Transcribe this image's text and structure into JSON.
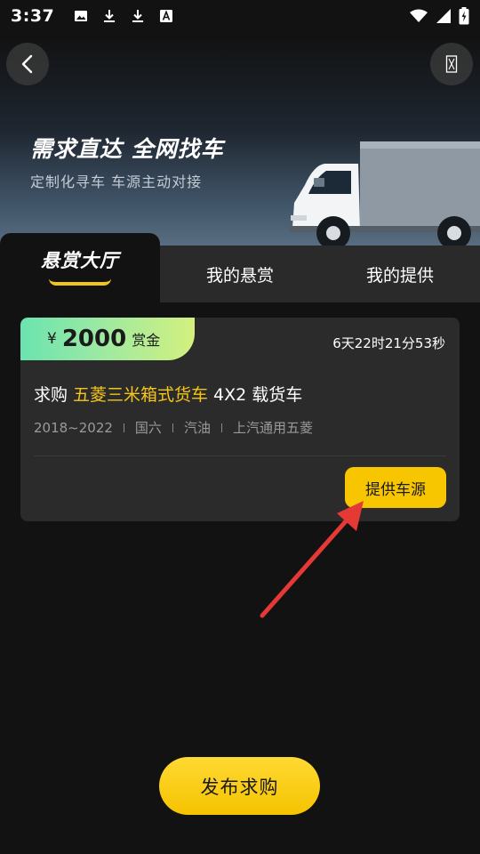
{
  "status_bar": {
    "time": "3:37",
    "icons": [
      "image-icon",
      "download-icon",
      "download-icon",
      "font-icon",
      "wifi-icon",
      "signal-icon",
      "battery-charging-icon"
    ]
  },
  "header": {
    "back_icon": "chevron-left-icon",
    "menu_icon": "more-icon",
    "title": "需求直达 全网找车",
    "subtitle": "定制化寻车 车源主动对接"
  },
  "tabs": [
    {
      "label": "悬赏大厅",
      "active": true
    },
    {
      "label": "我的悬赏",
      "active": false
    },
    {
      "label": "我的提供",
      "active": false
    }
  ],
  "card": {
    "bounty_currency": "¥",
    "bounty_amount": "2000",
    "bounty_unit": "赏金",
    "countdown": "6天22时21分53秒",
    "title_prefix": "求购",
    "title_highlight": "五菱三米箱式货车",
    "title_suffix": "4X2 载货车",
    "specs": [
      "2018~2022",
      "国六",
      "汽油",
      "上汽通用五菱"
    ],
    "action_label": "提供车源"
  },
  "footer": {
    "publish_label": "发布求购"
  },
  "colors": {
    "accent": "#f7c600",
    "highlight_text": "#f5c518",
    "annotation_arrow": "#e53935",
    "background": "#121212"
  }
}
